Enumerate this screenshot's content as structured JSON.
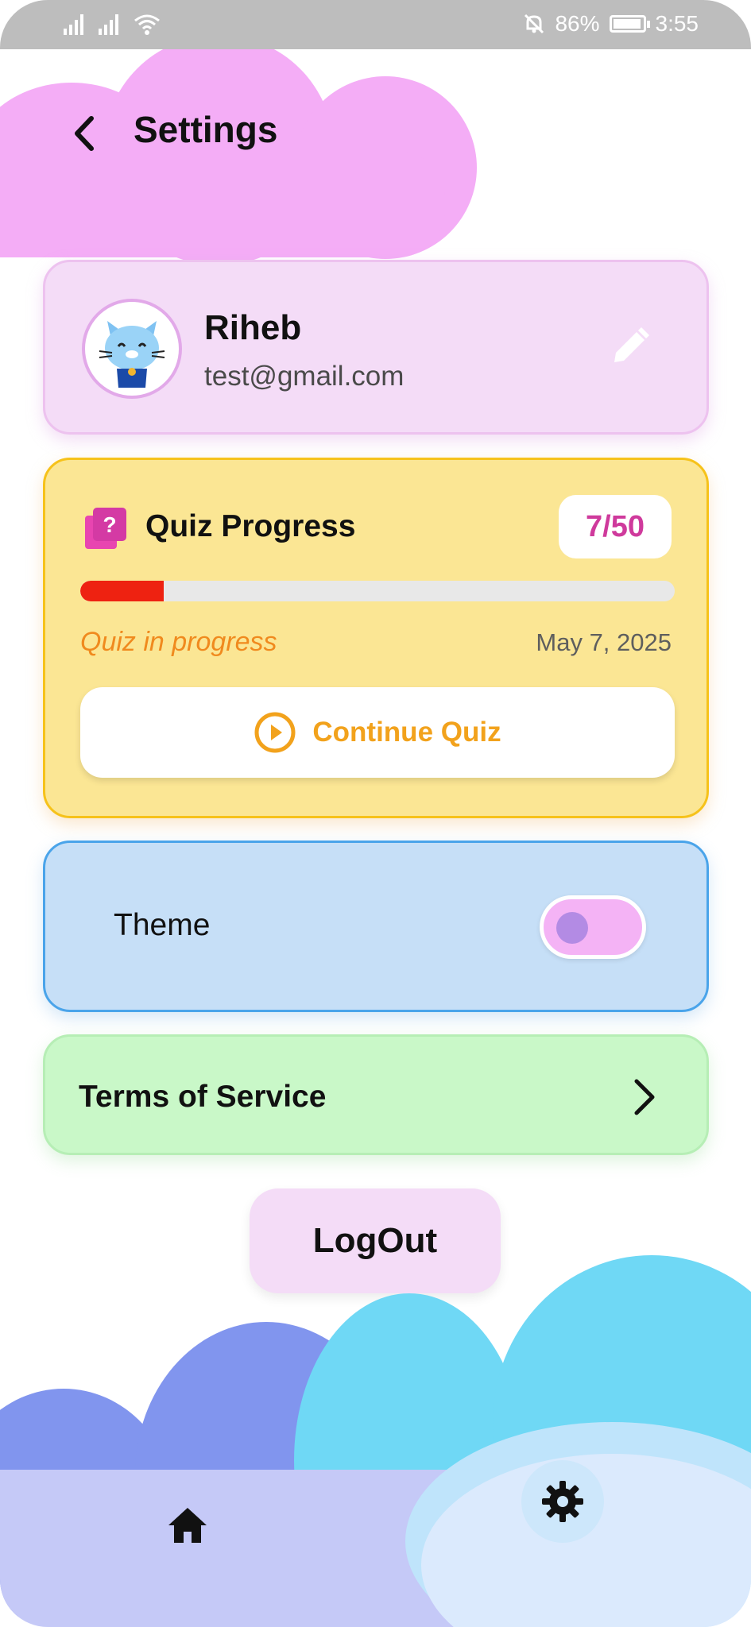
{
  "status_bar": {
    "battery": "86%",
    "time": "3:55",
    "icons": [
      "signal-icon",
      "signal-icon",
      "wifi-icon",
      "mute-icon",
      "battery-icon"
    ]
  },
  "header": {
    "title": "Settings",
    "back_icon": "chevron-left-icon"
  },
  "profile": {
    "name": "Riheb",
    "email": "test@gmail.com",
    "avatar_icon": "cat-avatar-icon",
    "edit_icon": "pencil-icon"
  },
  "quiz": {
    "title": "Quiz Progress",
    "count": "7/50",
    "progress": 0.14,
    "status": "Quiz in progress",
    "date": "May 7, 2025",
    "continue_label": "Continue Quiz",
    "icon": "quiz-book-icon"
  },
  "theme": {
    "label": "Theme",
    "enabled": false
  },
  "terms": {
    "label": "Terms of Service"
  },
  "logout": {
    "label": "LogOut"
  },
  "nav": {
    "items": [
      "home-icon",
      "gear-icon"
    ],
    "active": "settings"
  },
  "colors": {
    "profile_bg": "#f4dcf7",
    "quiz_bg": "#fbe694",
    "quiz_border": "#f6c21a",
    "theme_bg": "#c6dff7",
    "theme_border": "#4aa4ea",
    "terms_bg": "#c9f8c8",
    "progress_fill": "#ee2211",
    "accent_orange": "#f2a21c",
    "count_pink": "#cf3a9c"
  }
}
